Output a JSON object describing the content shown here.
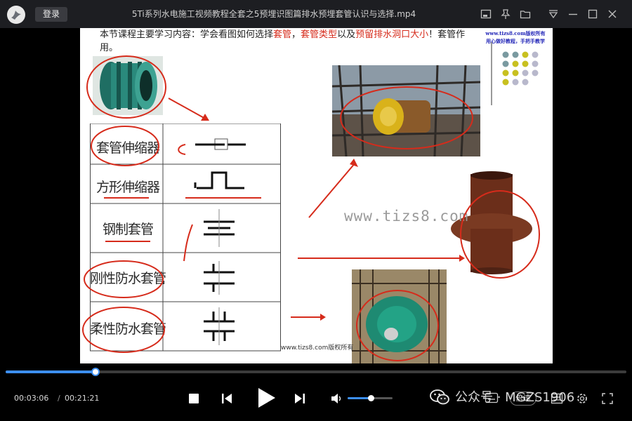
{
  "window": {
    "login_label": "登录",
    "title": "5Ti系列水电施工视频教程全套之5预埋识图篇排水预埋套管认识与选择.mp4"
  },
  "slide": {
    "heading_part1": "本节课程主要学习内容：学会看图如何选择",
    "heading_red1": "套管",
    "heading_part2": "，",
    "heading_red2": "套管类型",
    "heading_part3": "以及",
    "heading_red3": "预留排水洞口大小",
    "heading_part4": "！套管作用。",
    "site_line1": "www.tizs8.com版权所有",
    "site_line2": "用心做好教程，手把手教学",
    "watermark_mid": "www.tizs8.com",
    "watermark_bottom": "www.tizs8.com版权所有",
    "labels": [
      "套管伸缩器",
      "方形伸缩器",
      "钢制套管",
      "刚性防水套管",
      "柔性防水套管"
    ],
    "dot_colors": [
      "#7a9aa0",
      "#7a9aa0",
      "#c8c020",
      "#b8b8cc",
      "#7a9aa0",
      "#c8c020",
      "#c8c020",
      "#b8b8cc",
      "#c8c020",
      "#c8c020",
      "#b8b8cc",
      "#b8b8cc",
      "#c8c020",
      "#b8b8cc",
      "#b8b8cc"
    ]
  },
  "player": {
    "current_time": "00:03:06",
    "total_time": "00:21:21",
    "progress": 0.145,
    "volume": 0.52,
    "speed_label": "倍速"
  },
  "watermark": {
    "text": "公众号 · MGZS1906"
  },
  "colors": {
    "accent": "#3d8ff0",
    "annotation_red": "#d62b1b",
    "titlebar": "#1d1e22"
  }
}
